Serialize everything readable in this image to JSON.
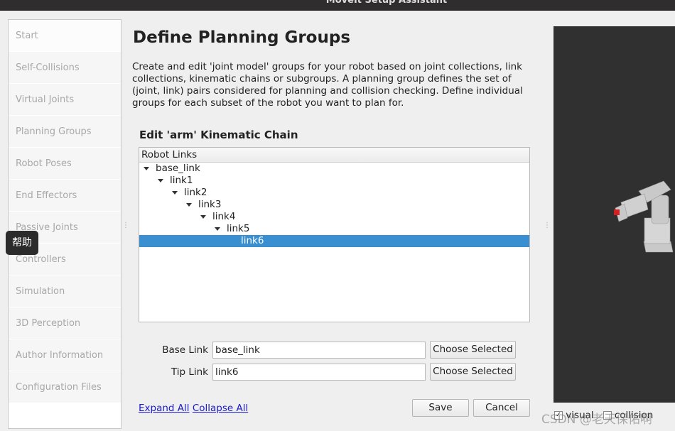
{
  "window": {
    "title": "MoveIt Setup Assistant"
  },
  "sidebar": {
    "items": [
      "Start",
      "Self-Collisions",
      "Virtual Joints",
      "Planning Groups",
      "Robot Poses",
      "End Effectors",
      "Passive Joints",
      "Controllers",
      "Simulation",
      "3D Perception",
      "Author Information",
      "Configuration Files"
    ]
  },
  "tooltip": "帮助",
  "main": {
    "title": "Define Planning Groups",
    "description": "Create and edit 'joint model' groups for your robot based on joint collections, link collections, kinematic chains or subgroups. A planning group defines the set of (joint, link) pairs considered for planning and collision checking. Define individual groups for each subset of the robot you want to plan for.",
    "subtitle": "Edit 'arm' Kinematic Chain",
    "tree": {
      "header": "Robot Links",
      "nodes": [
        {
          "label": "base_link",
          "depth": 0,
          "expanded": true
        },
        {
          "label": "link1",
          "depth": 1,
          "expanded": true
        },
        {
          "label": "link2",
          "depth": 2,
          "expanded": true
        },
        {
          "label": "link3",
          "depth": 3,
          "expanded": true
        },
        {
          "label": "link4",
          "depth": 4,
          "expanded": true
        },
        {
          "label": "link5",
          "depth": 5,
          "expanded": true
        },
        {
          "label": "link6",
          "depth": 6,
          "selected": true
        }
      ]
    },
    "base_link": {
      "label": "Base Link",
      "value": "base_link",
      "button": "Choose Selected"
    },
    "tip_link": {
      "label": "Tip Link",
      "value": "link6",
      "button": "Choose Selected"
    },
    "expand_all": "Expand All",
    "collapse_all": "Collapse All",
    "save": "Save",
    "cancel": "Cancel"
  },
  "viewer": {
    "visual_label": "visual",
    "visual_checked": true,
    "collision_label": "collision",
    "collision_checked": false,
    "background": "#303030"
  },
  "watermark": "CSDN @老天保佑啊",
  "colors": {
    "selection": "#3a8fd0",
    "link": "#1a1acc"
  }
}
